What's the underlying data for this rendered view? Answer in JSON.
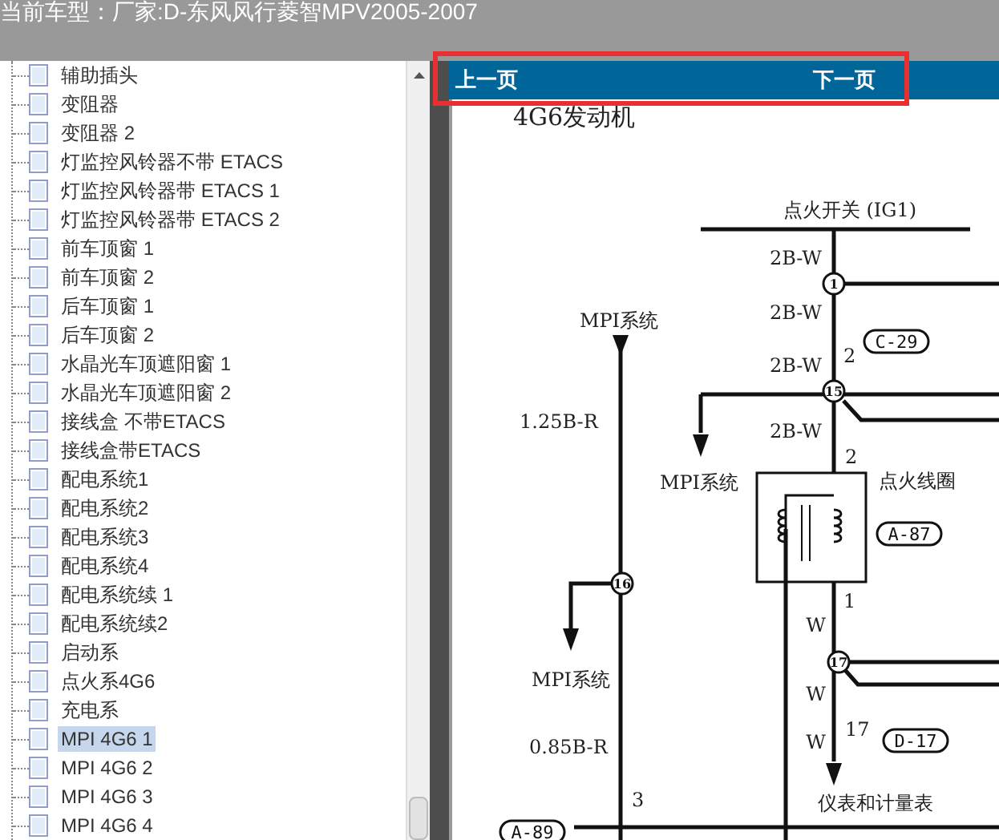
{
  "header": {
    "title": "当前车型：厂家:D-东风风行菱智MPV2005-2007"
  },
  "tree": {
    "items": [
      {
        "label": "辅助插头",
        "selected": false
      },
      {
        "label": "变阻器",
        "selected": false
      },
      {
        "label": "变阻器 2",
        "selected": false
      },
      {
        "label": "灯监控风铃器不带 ETACS",
        "selected": false
      },
      {
        "label": "灯监控风铃器带 ETACS 1",
        "selected": false
      },
      {
        "label": "灯监控风铃器带 ETACS 2",
        "selected": false
      },
      {
        "label": "前车顶窗 1",
        "selected": false
      },
      {
        "label": "前车顶窗 2",
        "selected": false
      },
      {
        "label": "后车顶窗 1",
        "selected": false
      },
      {
        "label": "后车顶窗 2",
        "selected": false
      },
      {
        "label": "水晶光车顶遮阳窗 1",
        "selected": false
      },
      {
        "label": "水晶光车顶遮阳窗 2",
        "selected": false
      },
      {
        "label": "接线盒 不带ETACS",
        "selected": false
      },
      {
        "label": "接线盒带ETACS",
        "selected": false
      },
      {
        "label": "配电系统1",
        "selected": false
      },
      {
        "label": "配电系统2",
        "selected": false
      },
      {
        "label": "配电系统3",
        "selected": false
      },
      {
        "label": "配电系统4",
        "selected": false
      },
      {
        "label": "配电系统续 1",
        "selected": false
      },
      {
        "label": "配电系统续2",
        "selected": false
      },
      {
        "label": "启动系",
        "selected": false
      },
      {
        "label": "点火系4G6",
        "selected": false
      },
      {
        "label": "充电系",
        "selected": false
      },
      {
        "label": "MPI 4G6 1",
        "selected": true
      },
      {
        "label": "MPI 4G6 2",
        "selected": false
      },
      {
        "label": "MPI 4G6 3",
        "selected": false
      },
      {
        "label": "MPI 4G6 4",
        "selected": false
      }
    ]
  },
  "nav_bar": {
    "highlighted": true,
    "prev": "上一页",
    "next": "下一页"
  },
  "diagram": {
    "title": "4G6发动机",
    "labels": [
      "点火开关 (IG1)",
      "2B-W",
      "2B-W",
      "2B-W",
      "2B-W",
      "MPI系统",
      "1.25B-R",
      "MPI系统",
      "2",
      "2",
      "点火线圈",
      "1",
      "W",
      "W",
      "W",
      "17",
      "仪表和计量表",
      "MPI系统",
      "0.85B-R",
      "3"
    ],
    "nodes": [
      "1",
      "15",
      "16",
      "17"
    ],
    "connectors": [
      "C-29",
      "A-87",
      "D-17",
      "A-89"
    ]
  }
}
